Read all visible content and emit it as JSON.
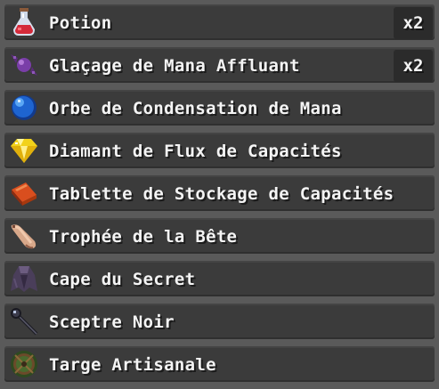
{
  "items": [
    {
      "label": "Potion",
      "count": "x2",
      "icon": "potion-icon"
    },
    {
      "label": "Glaçage de Mana Affluant",
      "count": "x2",
      "icon": "candy-icon"
    },
    {
      "label": "Orbe de Condensation de Mana",
      "count": null,
      "icon": "orb-icon"
    },
    {
      "label": "Diamant de Flux de Capacités",
      "count": null,
      "icon": "diamond-icon"
    },
    {
      "label": "Tablette de Stockage de Capacités",
      "count": null,
      "icon": "tablet-icon"
    },
    {
      "label": "Trophée de la Bête",
      "count": null,
      "icon": "horn-icon"
    },
    {
      "label": "Cape du Secret",
      "count": null,
      "icon": "cape-icon"
    },
    {
      "label": "Sceptre Noir",
      "count": null,
      "icon": "scepter-icon"
    },
    {
      "label": "Targe Artisanale",
      "count": null,
      "icon": "shield-icon"
    }
  ],
  "colors": {
    "background": "#5a5a5a",
    "row": "#3b3b3b",
    "badge": "#2b2b2b",
    "text": "#f4f4f4"
  }
}
